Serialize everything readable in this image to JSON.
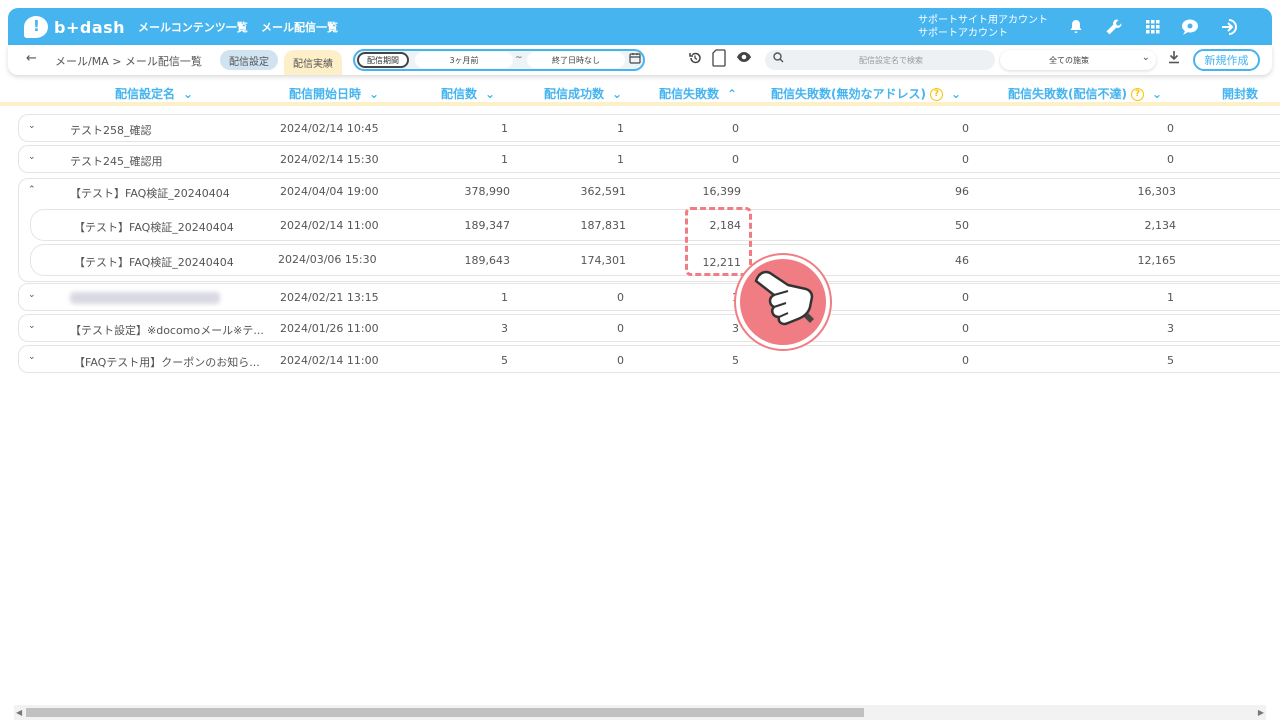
{
  "app": {
    "logo_text": "b+dash"
  },
  "header": {
    "nav": [
      "メールコンテンツ一覧",
      "メール配信一覧"
    ],
    "account_line1": "サポートサイト用アカウント",
    "account_line2": "サポートアカウント"
  },
  "subheader": {
    "back_glyph": "←",
    "breadcrumb": "メール/MA > メール配信一覧",
    "tab_settings": "配信設定",
    "tab_results": "配信実績",
    "period_label": "配信期間",
    "period_from": "3ヶ月前",
    "period_tilde": "~",
    "period_to": "終了日時なし",
    "search_placeholder": "配信設定名で検索",
    "filter_value": "全ての施策",
    "new_button": "新規作成"
  },
  "table": {
    "headers": {
      "name": "配信設定名",
      "start": "配信開始日時",
      "count": "配信数",
      "success": "配信成功数",
      "failed": "配信失敗数",
      "failed_invalid": "配信失敗数(無効なアドレス)",
      "failed_undelivered": "配信失敗数(配信不達)",
      "opens": "開封数"
    },
    "rows": [
      {
        "expand": "⌄",
        "name": "テスト258_確認",
        "start": "2024/02/14 10:45",
        "count": "1",
        "success": "1",
        "failed": "0",
        "failed_invalid": "0",
        "failed_undelivered": "0"
      },
      {
        "expand": "⌄",
        "name": "テスト245_確認用",
        "start": "2024/02/14 15:30",
        "count": "1",
        "success": "1",
        "failed": "0",
        "failed_invalid": "0",
        "failed_undelivered": "0"
      }
    ],
    "group": {
      "expand": "⌃",
      "name": "【テスト】FAQ検証_20240404",
      "start": "2024/04/04 19:00",
      "count": "378,990",
      "success": "362,591",
      "failed": "16,399",
      "failed_invalid": "96",
      "failed_undelivered": "16,303",
      "children": [
        {
          "name": "【テスト】FAQ検証_20240404",
          "start": "2024/02/14 11:00",
          "count": "189,347",
          "success": "187,831",
          "failed": "2,184",
          "failed_invalid": "50",
          "failed_undelivered": "2,134"
        },
        {
          "name": "【テスト】FAQ検証_20240404",
          "start": "2024/03/06 15:30",
          "count": "189,643",
          "success": "174,301",
          "failed": "12,211",
          "failed_invalid": "46",
          "failed_undelivered": "12,165"
        }
      ]
    },
    "rows_after": [
      {
        "expand": "⌄",
        "name": "",
        "start": "2024/02/21 13:15",
        "count": "1",
        "success": "0",
        "failed": "1",
        "failed_invalid": "0",
        "failed_undelivered": "1"
      },
      {
        "expand": "⌄",
        "name": "【テスト設定】※docomoメール※テ...",
        "start": "2024/01/26 11:00",
        "count": "3",
        "success": "0",
        "failed": "3",
        "failed_invalid": "0",
        "failed_undelivered": "3"
      },
      {
        "expand": "⌄",
        "name": "【FAQテスト用】クーポンのお知ら...",
        "start": "2024/02/14 11:00",
        "count": "5",
        "success": "0",
        "failed": "5",
        "failed_invalid": "0",
        "failed_undelivered": "5"
      }
    ]
  },
  "colors": {
    "brand": "#45b4ef",
    "highlight": "#f07c84",
    "tab_active": "#fdf0c8"
  }
}
